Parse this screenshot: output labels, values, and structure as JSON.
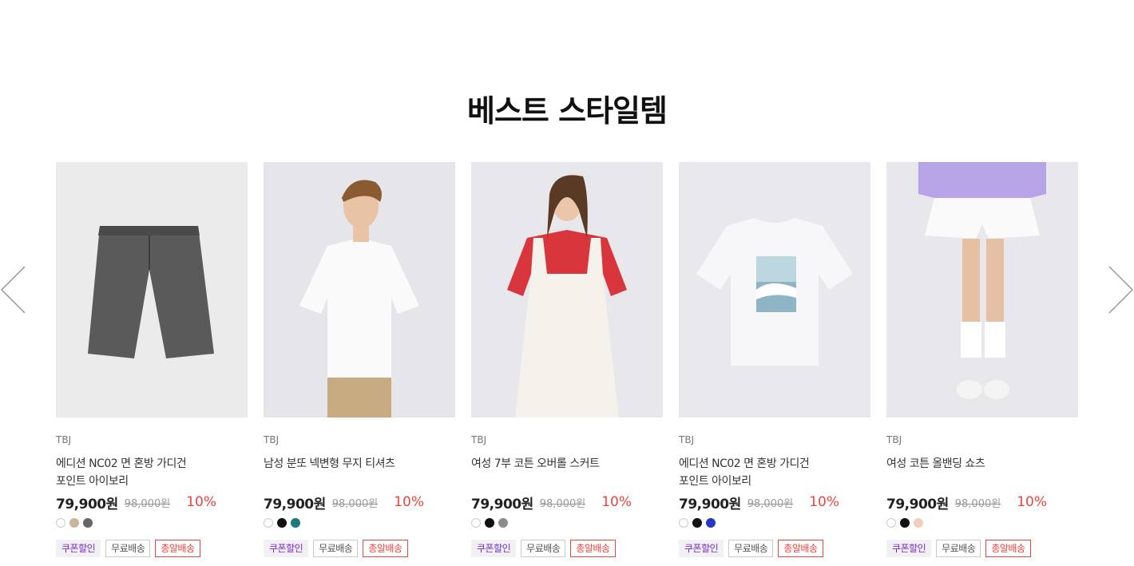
{
  "section_title": "베스트 스타일템",
  "nav": {
    "prev_icon": "chevron-left-icon",
    "next_icon": "chevron-right-icon"
  },
  "products": [
    {
      "brand": "TBJ",
      "name_line1": "에디션 NC02 면 혼방 가디건",
      "name_line2": "포인트 아이보리",
      "price": "79,900원",
      "original_price": "98,000원",
      "discount": "10%",
      "colors": [
        "#ffffff",
        "#c8b79a",
        "#666666"
      ],
      "badges": [
        "쿠폰할인",
        "무료배송",
        "총알배송"
      ],
      "image": "gray-tweed-shorts"
    },
    {
      "brand": "TBJ",
      "name_line1": "남성 분또 넥변형 무지 티셔츠",
      "name_line2": "",
      "price": "79,900원",
      "original_price": "98,000원",
      "discount": "10%",
      "colors": [
        "#ffffff",
        "#111111",
        "#1e7a7a"
      ],
      "badges": [
        "쿠폰할인",
        "무료배송",
        "총알배송"
      ],
      "image": "man-white-tshirt"
    },
    {
      "brand": "TBJ",
      "name_line1": "여성 7부 코튼 오버롤 스커트",
      "name_line2": "",
      "price": "79,900원",
      "original_price": "98,000원",
      "discount": "10%",
      "colors": [
        "#ffffff",
        "#111111",
        "#8a8d90"
      ],
      "badges": [
        "쿠폰할인",
        "무료배송",
        "총알배송"
      ],
      "image": "woman-overall-skirt"
    },
    {
      "brand": "TBJ",
      "name_line1": "에디션 NC02 면 혼방 가디건",
      "name_line2": "포인트 아이보리",
      "price": "79,900원",
      "original_price": "98,000원",
      "discount": "10%",
      "colors": [
        "#ffffff",
        "#111111",
        "#2438c8"
      ],
      "badges": [
        "쿠폰할인",
        "무료배송",
        "총알배송"
      ],
      "image": "white-print-tshirt"
    },
    {
      "brand": "TBJ",
      "name_line1": "여성 코튼 올밴딩 쇼츠",
      "name_line2": "",
      "price": "79,900원",
      "original_price": "98,000원",
      "discount": "10%",
      "colors": [
        "#ffffff",
        "#111111",
        "#f0cfc0"
      ],
      "badges": [
        "쿠폰할인",
        "무료배송",
        "총알배송"
      ],
      "image": "woman-white-shorts"
    }
  ]
}
